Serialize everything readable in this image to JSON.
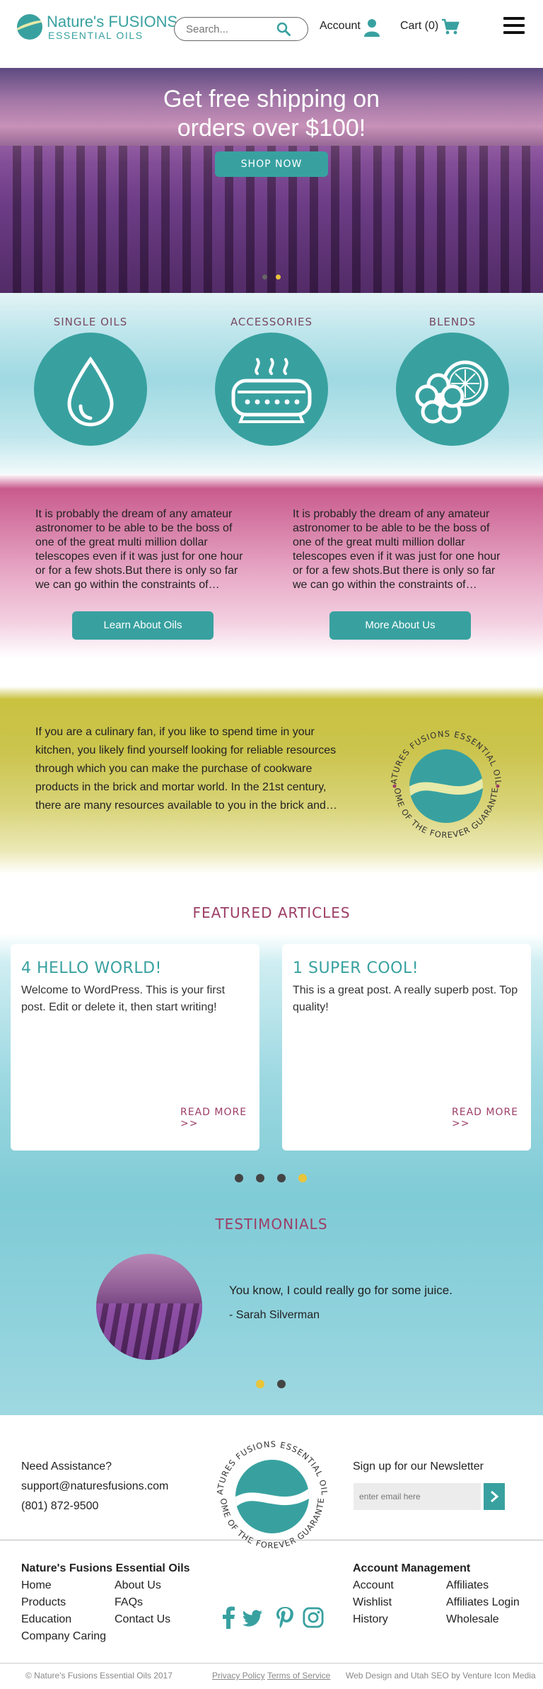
{
  "header": {
    "logo_main": "Nature's FUSIONS",
    "logo_sub": "ESSENTIAL OILS",
    "search_placeholder": "Search...",
    "account_label": "Account",
    "cart_label": "Cart (0)"
  },
  "hero": {
    "title_line1": "Get free shipping on",
    "title_line2": "orders over $100!",
    "button_label": "SHOP NOW",
    "slides": 2,
    "active_slide": 2
  },
  "categories": [
    {
      "label": "SINGLE OILS",
      "icon": "oil-drop-icon"
    },
    {
      "label": "ACCESSORIES",
      "icon": "diffuser-icon"
    },
    {
      "label": "BLENDS",
      "icon": "flower-citrus-icon"
    }
  ],
  "promo": [
    {
      "text": "It is probably the dream of any amateur astronomer to be able to be the boss of one of the great multi million dollar telescopes even if it was just for one hour or for a few shots.But there is only so far we can go within the constraints of…",
      "button": "Learn About Oils"
    },
    {
      "text": "It is probably the dream of any amateur astronomer to be able to be the boss of one of the great multi million dollar telescopes even if it was just for one hour or for a few shots.But there is only so far we can go within the constraints of…",
      "button": "More About Us"
    }
  ],
  "guarantee": {
    "text": "If you are a culinary fan, if you like to spend time in your kitchen, you likely find yourself looking for reliable resources through which you can make the purchase of cookware products in the brick and mortar world. In the 21st century, there are many resources available to you in the brick and…",
    "seal_top": "NATURES FUSIONS ESSENTIAL OILS",
    "seal_bottom": "HOME OF THE FOREVER GUARANTEE"
  },
  "featured": {
    "title": "FEATURED ARTICLES",
    "articles": [
      {
        "title": "4 HELLO WORLD!",
        "text": "Welcome to WordPress. This is your first post. Edit or delete it, then start writing!",
        "more": "READ MORE >>"
      },
      {
        "title": "1 SUPER COOL!",
        "text": "This is a great post. A really superb post. Top quality!",
        "more": "READ MORE >>"
      }
    ],
    "pages": 4,
    "active_page": 4
  },
  "testimonials": {
    "title": "TESTIMONIALS",
    "quote": "You know, I could really go for some juice.",
    "author": "- Sarah Silverman",
    "pages": 2,
    "active_page": 1
  },
  "footer": {
    "assist": "Need Assistance?",
    "email": "support@naturesfusions.com",
    "phone": "(801) 872-9500",
    "newsletter_label": "Sign up for our Newsletter",
    "newsletter_placeholder": "enter email here",
    "col1_title": "Nature's Fusions Essential Oils",
    "col1_links": [
      "Home",
      "About Us",
      "Products",
      "FAQs",
      "Education",
      "Contact Us",
      "Company Caring"
    ],
    "col2_title": "Account Management",
    "col2_links": [
      "Account",
      "Affiliates",
      "Wishlist",
      "Affiliates Login",
      "History",
      "Wholesale"
    ],
    "copyright": "© Nature's Fusions Essential Oils 2017",
    "privacy": "Privacy Policy",
    "terms": "Terms of Service",
    "credit": "Web Design and Utah SEO by Venture Icon Media"
  },
  "colors": {
    "teal": "#38a1a0",
    "plum": "#9c3e66",
    "yellow_dot": "#e8c53a",
    "dark_dot": "#444444"
  }
}
